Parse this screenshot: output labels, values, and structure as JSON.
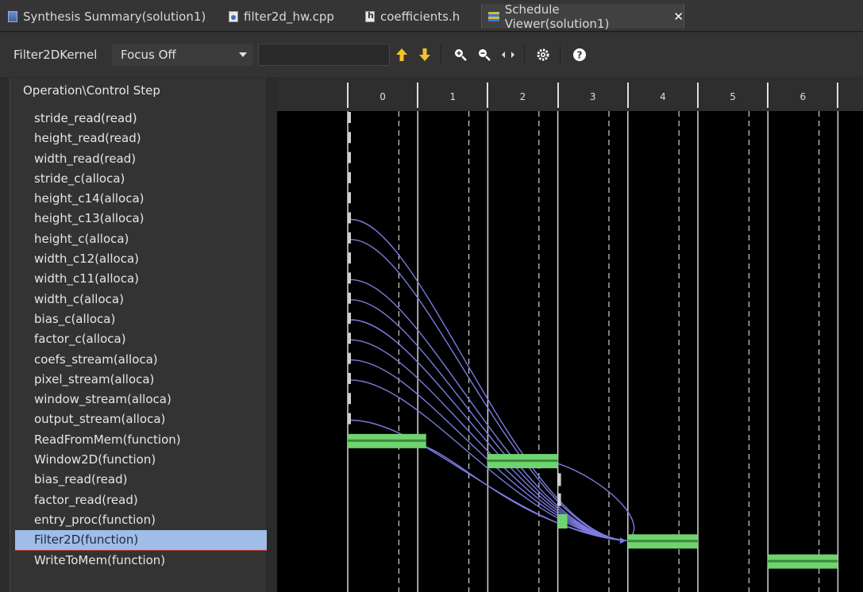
{
  "tabs": [
    {
      "label": "Synthesis Summary(solution1)",
      "icon": "summary-icon"
    },
    {
      "label": "filter2d_hw.cpp",
      "icon": "cpp-file-icon"
    },
    {
      "label": "coefficients.h",
      "icon": "header-file-icon"
    },
    {
      "label": "Schedule Viewer(solution1)",
      "icon": "schedule-icon",
      "active": true
    }
  ],
  "toolbar": {
    "module": "Filter2DKernel",
    "focus_value": "Focus Off",
    "search_value": ""
  },
  "panel": {
    "header": "Operation\\Control Step",
    "operations": [
      "stride_read(read)",
      "height_read(read)",
      "width_read(read)",
      "stride_c(alloca)",
      "height_c14(alloca)",
      "height_c13(alloca)",
      "height_c(alloca)",
      "width_c12(alloca)",
      "width_c11(alloca)",
      "width_c(alloca)",
      "bias_c(alloca)",
      "factor_c(alloca)",
      "coefs_stream(alloca)",
      "pixel_stream(alloca)",
      "window_stream(alloca)",
      "output_stream(alloca)",
      "ReadFromMem(function)",
      "Window2D(function)",
      "bias_read(read)",
      "factor_read(read)",
      "entry_proc(function)",
      "Filter2D(function)",
      "WriteToMem(function)"
    ],
    "selected_index": 21
  },
  "steps": [
    "0",
    "1",
    "2",
    "3",
    "4",
    "5",
    "6"
  ],
  "colors": {
    "bar": "#6fd36f",
    "bar_dark": "#3a8a3a",
    "edge": "#7b7be0",
    "selection": "#9fbde7"
  }
}
